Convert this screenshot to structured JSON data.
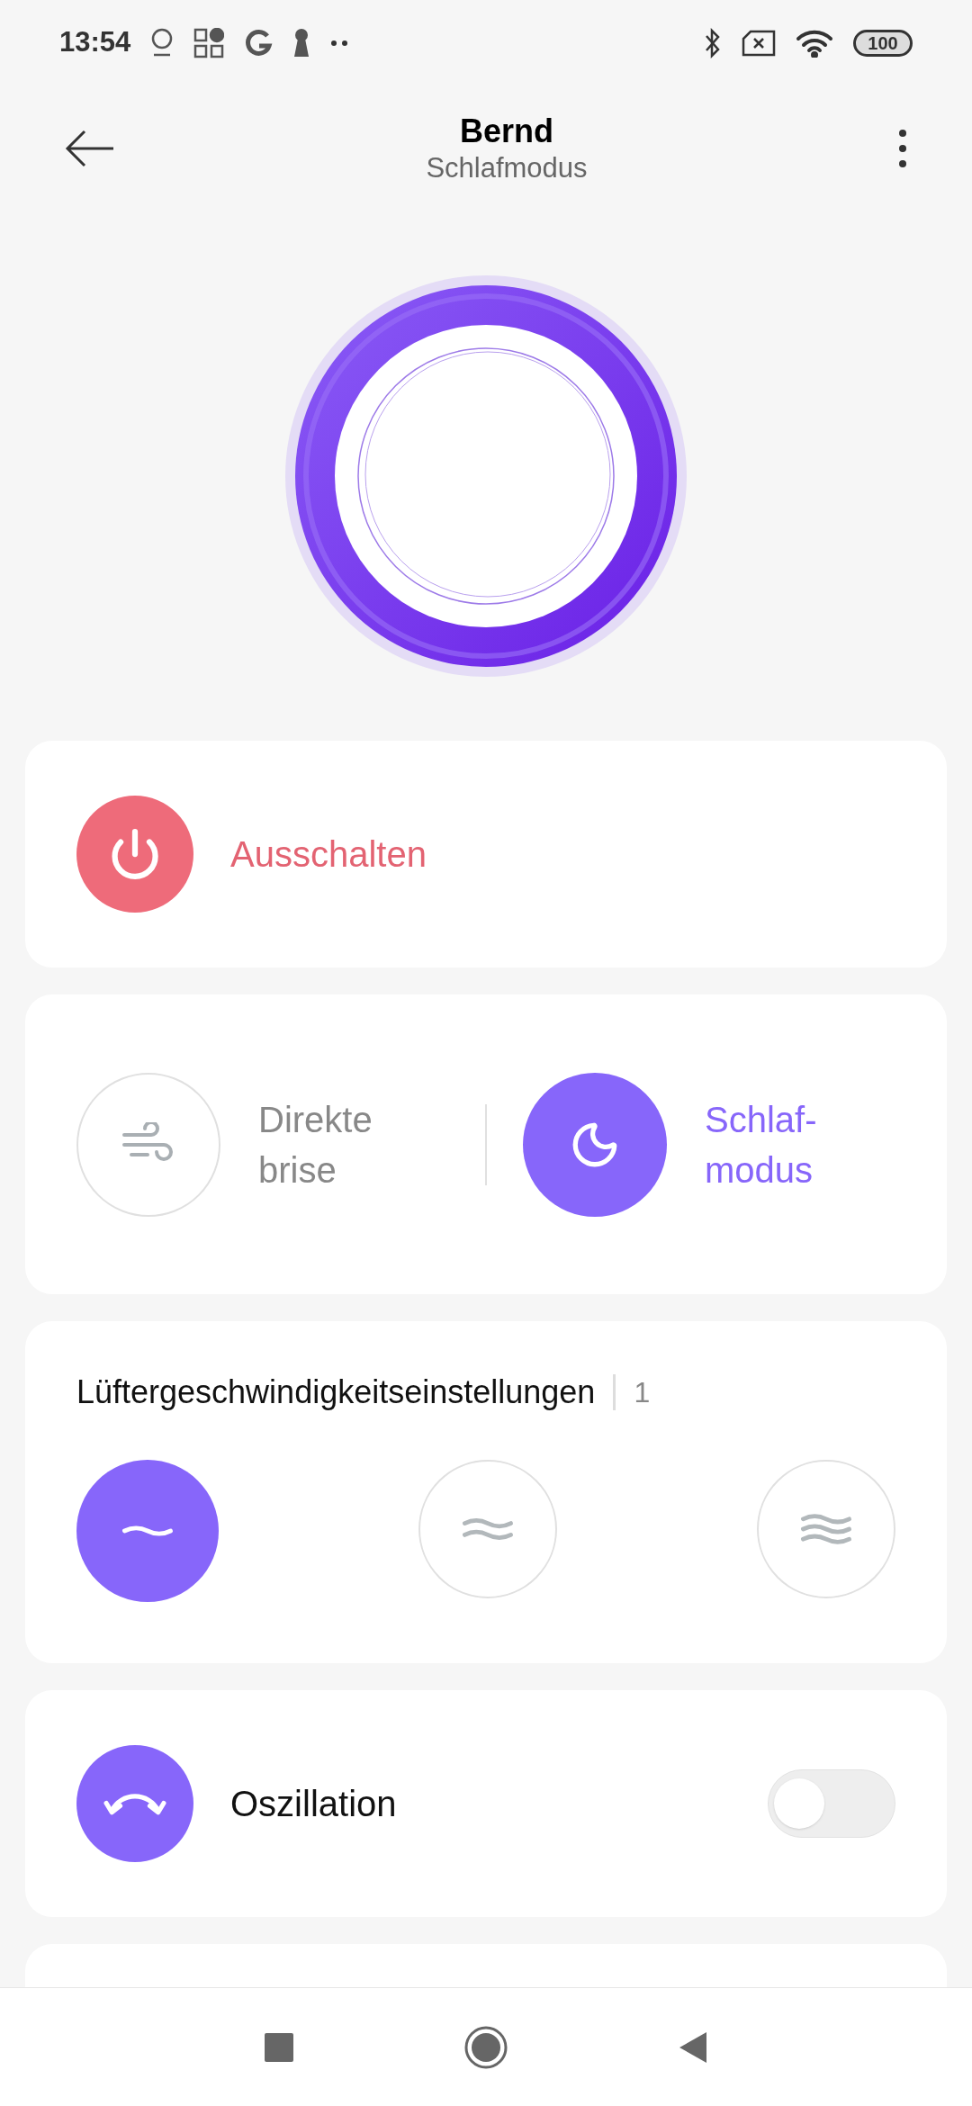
{
  "status_bar": {
    "time": "13:54",
    "battery": "100"
  },
  "header": {
    "title": "Bernd",
    "subtitle": "Schlafmodus"
  },
  "power": {
    "label": "Ausschalten"
  },
  "modes": [
    {
      "kind": "breeze",
      "label": "Direkte brise",
      "selected": false
    },
    {
      "kind": "sleep",
      "label": "Schlaf-modus",
      "selected": true
    }
  ],
  "fan_speed": {
    "title": "Lüftergeschwindigkeitseinstellungen",
    "value": "1",
    "speeds": [
      {
        "selected": true
      },
      {
        "selected": false
      },
      {
        "selected": false
      }
    ]
  },
  "oscillation": {
    "label": "Oszillation",
    "on": false
  }
}
